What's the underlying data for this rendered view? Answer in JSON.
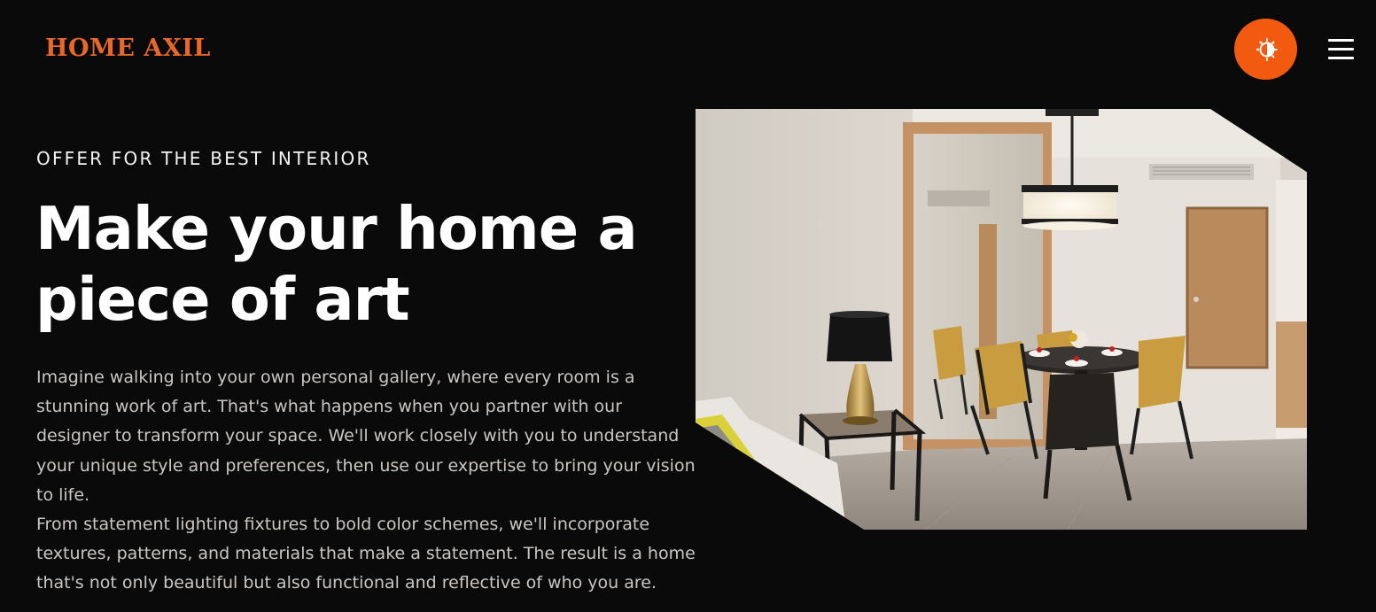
{
  "header": {
    "logo_text": "HOME AXIL",
    "theme_toggle_icon": "sun-moon-icon",
    "menu_icon": "hamburger-menu-icon"
  },
  "hero": {
    "eyebrow": "OFFER FOR THE BEST INTERIOR",
    "title": "Make your home a piece of art",
    "paragraphs": [
      "Imagine walking into your own personal gallery, where every room is a stunning work of art. That's what happens when you partner with our designer to transform your space. We'll work closely with you to understand your unique style and preferences, then use our expertise to bring your vision to life.",
      "From statement lighting fixtures to bold color schemes, we'll incorporate textures, patterns, and materials that make a statement. The result is a home that's not only beautiful but also functional and reflective of who you are."
    ],
    "image_subject": "interior-dining-room-photo"
  },
  "colors": {
    "background": "#0b0a0a",
    "accent": "#f25a0f",
    "logo": "#e8672a",
    "text_primary": "#ffffff",
    "text_secondary": "#c9c6c3"
  }
}
